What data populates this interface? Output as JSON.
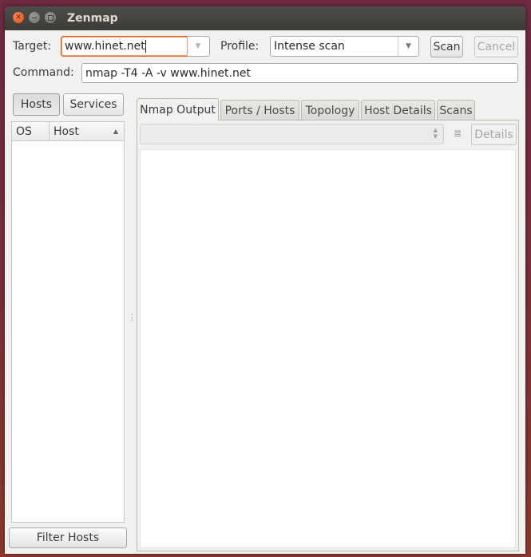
{
  "window": {
    "title": "Zenmap"
  },
  "toolbar": {
    "target_label": "Target:",
    "target_value": "www.hinet.net",
    "profile_label": "Profile:",
    "profile_value": "Intense scan",
    "scan_label": "Scan",
    "cancel_label": "Cancel",
    "command_label": "Command:",
    "command_value": "nmap -T4 -A -v www.hinet.net"
  },
  "sidebar": {
    "hosts_label": "Hosts",
    "services_label": "Services",
    "columns": [
      "OS",
      "Host"
    ],
    "filter_label": "Filter Hosts"
  },
  "tabs": [
    "Nmap Output",
    "Ports / Hosts",
    "Topology",
    "Host Details",
    "Scans"
  ],
  "output": {
    "details_label": "Details"
  },
  "icons": {
    "close": "close-icon",
    "minimize": "minimize-icon",
    "maximize": "maximize-icon",
    "dropdown": "chevron-down-icon",
    "sort": "sort-ascending-icon",
    "spinner": "spinner-arrows-icon"
  }
}
